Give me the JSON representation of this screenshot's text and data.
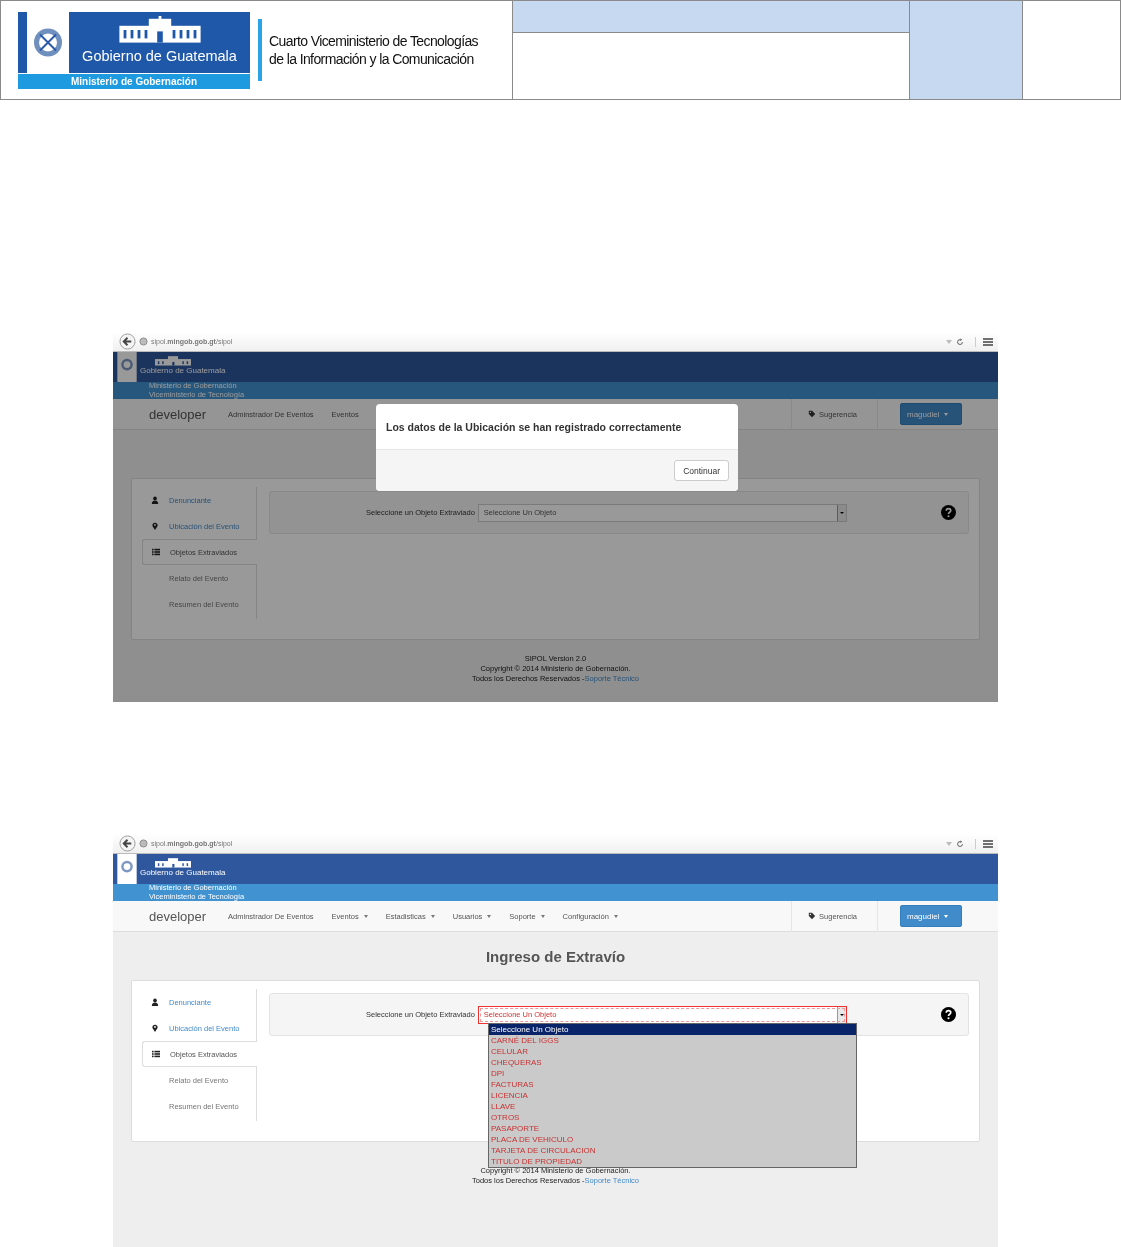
{
  "document_header": {
    "logo": {
      "title": "Gobierno de Guatemala",
      "subtitle": "Ministerio de Gobernación"
    },
    "heading_lines": [
      "Cuarto Viceministerio de Tecnologías",
      "de la Información y la Comunicación"
    ]
  },
  "screenshots": [
    {
      "url": "sipol.**mingob.gob.gt**/sipol",
      "brand": {
        "title": "Gobierno de Guatemala",
        "lines": [
          "Ministerio de Gobernación",
          "Viceministerio de Tecnología"
        ]
      },
      "app_name": "developer",
      "nav": [
        {
          "label": "Adminstrador De Eventos",
          "caret": false
        },
        {
          "label": "Eventos",
          "caret": false
        }
      ],
      "suggestion": "Sugerencia",
      "user": "magudiel",
      "sidebar": [
        {
          "label": "Denunciante",
          "selected": false,
          "disabled": false
        },
        {
          "label": "Ubicación del Evento",
          "selected": false,
          "disabled": false
        },
        {
          "label": "Objetos Extraviados",
          "selected": true,
          "disabled": false
        },
        {
          "label": "Relato del Evento",
          "selected": false,
          "disabled": true
        },
        {
          "label": "Resumen del Evento",
          "selected": false,
          "disabled": true
        }
      ],
      "field": {
        "label": "Seleccione un Objeto Extraviado",
        "value": "Seleccione Un Objeto",
        "focused": false
      },
      "footer": [
        {
          "text": "SIPOL Version 2.0"
        },
        {
          "text": "Copyright © 2014 Ministerio de Gobernación."
        },
        {
          "text": "Todos los Derechos Reservados -",
          "link": "Soporte Técnico"
        }
      ],
      "modal": {
        "message": "Los datos de la Ubicación se han registrado correctamente",
        "button": "Continuar"
      }
    },
    {
      "url": "sipol.**mingob.gob.gt**/sipol",
      "brand": {
        "title": "Gobierno de Guatemala",
        "lines": [
          "Ministerio de Gobernación",
          "Viceministerio de Tecnología"
        ]
      },
      "app_name": "developer",
      "nav": [
        {
          "label": "Adminstrador De Eventos",
          "caret": false
        },
        {
          "label": "Eventos",
          "caret": true
        },
        {
          "label": "Estadisticas",
          "caret": true
        },
        {
          "label": "Usuarios",
          "caret": true
        },
        {
          "label": "Soporte",
          "caret": true
        },
        {
          "label": "Configuración",
          "caret": true
        }
      ],
      "suggestion": "Sugerencia",
      "user": "magudiel",
      "page_title": "Ingreso de Extravío",
      "sidebar": [
        {
          "label": "Denunciante",
          "selected": false,
          "disabled": false
        },
        {
          "label": "Ubicación del Evento",
          "selected": false,
          "disabled": false
        },
        {
          "label": "Objetos Extraviados",
          "selected": true,
          "disabled": false
        },
        {
          "label": "Relato del Evento",
          "selected": false,
          "disabled": true
        },
        {
          "label": "Resumen del Evento",
          "selected": false,
          "disabled": true
        }
      ],
      "field": {
        "label": "Seleccione un Objeto Extraviado",
        "value": "Seleccione Un Objeto",
        "focused": true
      },
      "dropdown": [
        {
          "label": "Seleccione Un Objeto",
          "selected": true
        },
        {
          "label": "CARNÉ DEL IGGS",
          "selected": false
        },
        {
          "label": "CELULAR",
          "selected": false
        },
        {
          "label": "CHEQUERAS",
          "selected": false
        },
        {
          "label": "DPI",
          "selected": false
        },
        {
          "label": "FACTURAS",
          "selected": false
        },
        {
          "label": "LICENCIA",
          "selected": false
        },
        {
          "label": "LLAVE",
          "selected": false
        },
        {
          "label": "OTROS",
          "selected": false
        },
        {
          "label": "PASAPORTE",
          "selected": false
        },
        {
          "label": "PLACA DE VEHICULO",
          "selected": false
        },
        {
          "label": "TARJETA DE CIRCULACION",
          "selected": false
        },
        {
          "label": "TITULO DE PROPIEDAD",
          "selected": false
        }
      ],
      "footer": [
        {
          "text": "Copyright © 2014 Ministerio de Gobernación."
        },
        {
          "text": "Todos los Derechos Reservados -",
          "link": "Soporte Técnico"
        }
      ]
    }
  ]
}
